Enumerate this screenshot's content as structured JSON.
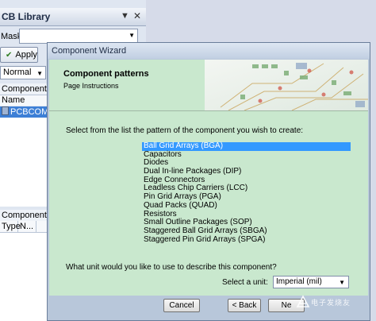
{
  "panel": {
    "title": "CB Library",
    "mask_label": "Mask",
    "mask_value": "",
    "apply_label": "Apply",
    "mode_value": "Normal",
    "components_header": "Components",
    "name_column": "Name",
    "selected_component": "PCBCOMPO",
    "component_props_header": "Component Pr",
    "props_columns": [
      "Type",
      "N..."
    ]
  },
  "wizard": {
    "title": "Component Wizard",
    "heading": "Component patterns",
    "subheading": "Page Instructions",
    "instructions": "Select from the list the pattern of the component you wish to create:",
    "patterns": [
      "Ball Grid Arrays (BGA)",
      "Capacitors",
      "Diodes",
      "Dual In-line Packages (DIP)",
      "Edge Connectors",
      "Leadless Chip Carriers (LCC)",
      "Pin Grid Arrays (PGA)",
      "Quad Packs (QUAD)",
      "Resistors",
      "Small Outline Packages (SOP)",
      "Staggered Ball Grid Arrays (SBGA)",
      "Staggered Pin Grid Arrays (SPGA)"
    ],
    "selected_pattern": "Ball Grid Arrays (BGA)",
    "unit_question": "What unit would you like to use to describe this component?",
    "unit_label": "Select a unit:",
    "unit_value": "Imperial (mil)",
    "buttons": {
      "cancel": "Cancel",
      "back": "< Back",
      "next": "Ne"
    }
  },
  "watermark": {
    "text": "电子发烧友"
  },
  "colors": {
    "wizard_body": "#c9e8ce",
    "selection": "#3399ff",
    "chrome": "#b8c7da"
  }
}
